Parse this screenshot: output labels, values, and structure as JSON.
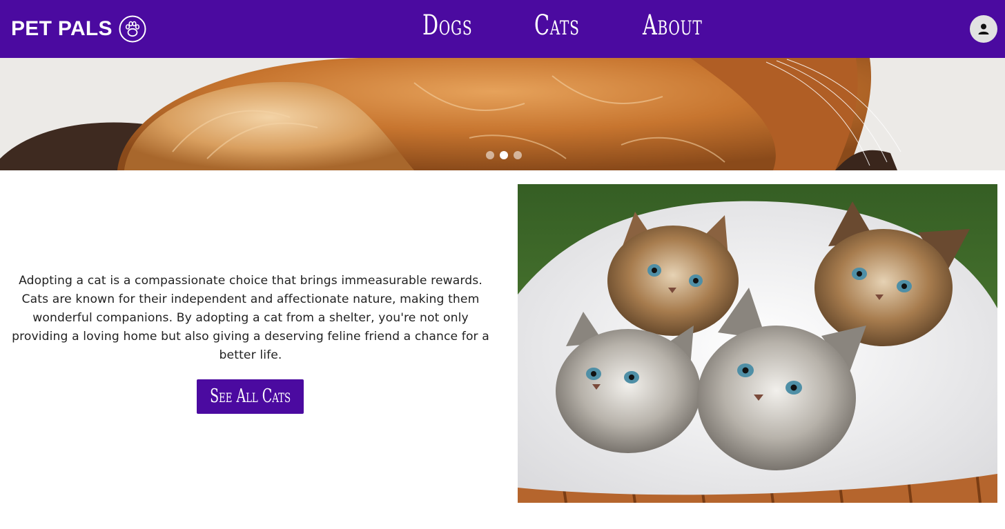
{
  "header": {
    "brand_name": "PET PALS",
    "brand_logo_icon": "paw-icon",
    "nav": [
      {
        "label": "Dogs"
      },
      {
        "label": "Cats"
      },
      {
        "label": "About"
      }
    ],
    "profile_icon": "user-icon"
  },
  "hero": {
    "slide_count": 3,
    "active_slide": 2
  },
  "cats_section": {
    "description": "Adopting a cat is a compassionate choice that brings immeasurable rewards. Cats are known for their independent and affectionate nature, making them wonderful companions. By adopting a cat from a shelter, you're not only providing a loving home but also giving a deserving feline friend a chance for a better life.",
    "cta_label": "See All Cats"
  },
  "colors": {
    "brand_purple": "#4b0aa0",
    "nav_text": "#ffffff",
    "avatar_bg": "#e2e2e2"
  }
}
